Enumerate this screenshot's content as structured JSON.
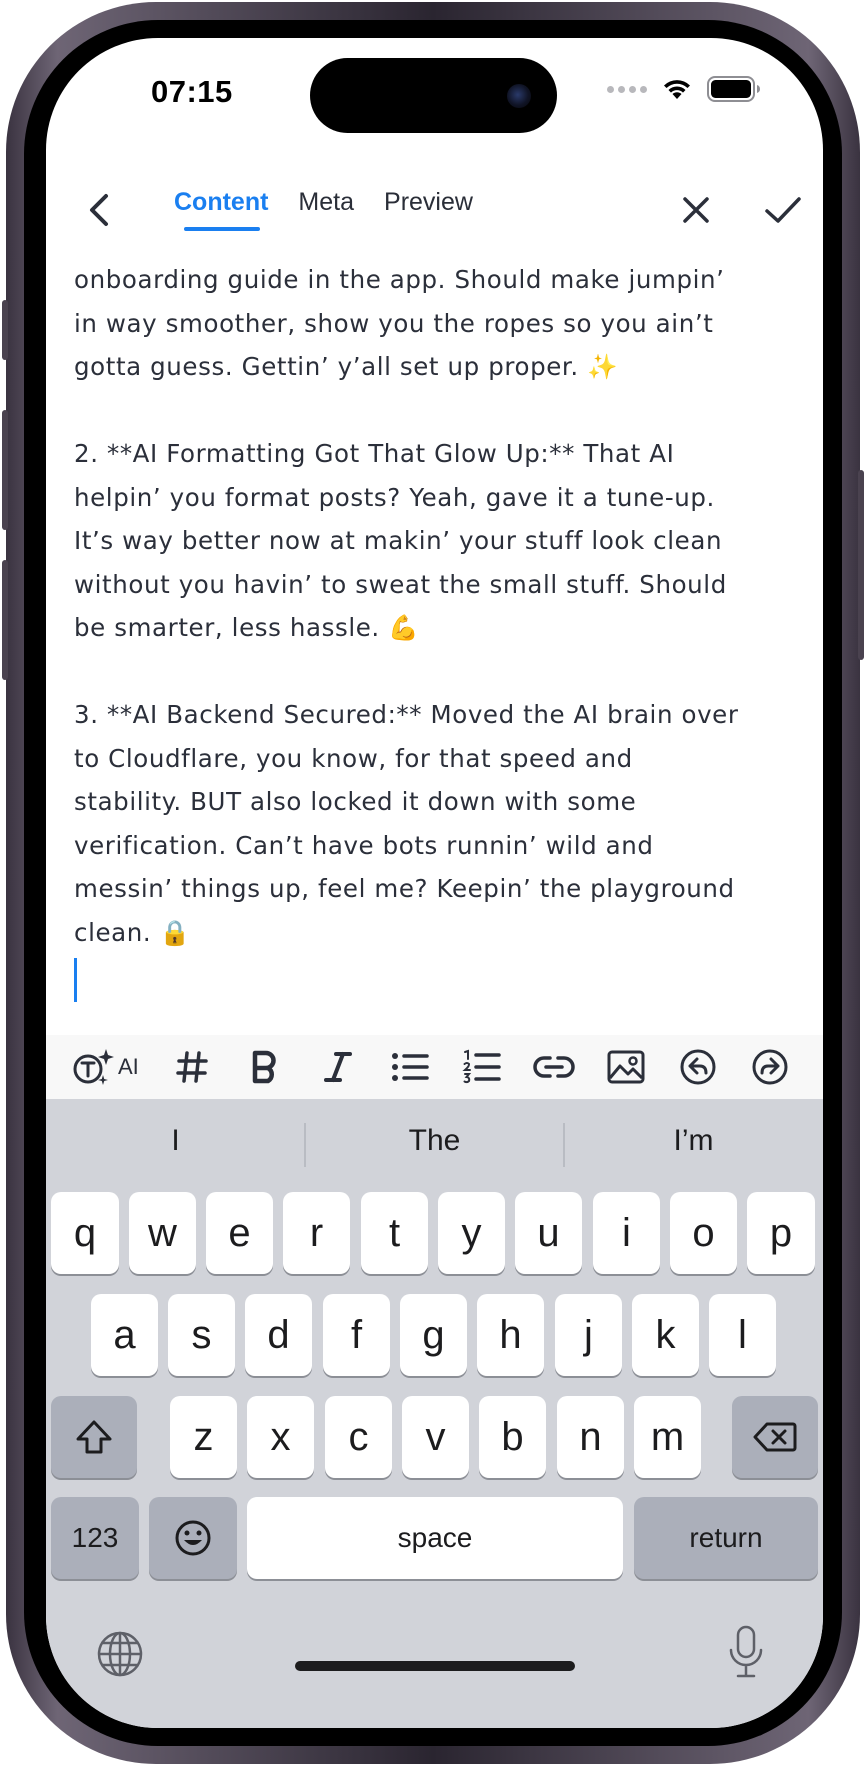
{
  "status_bar": {
    "time": "07:15"
  },
  "editor": {
    "tabs": [
      {
        "label": "Content",
        "active": true
      },
      {
        "label": "Meta",
        "active": false
      },
      {
        "label": "Preview",
        "active": false
      }
    ],
    "accent_color": "#1a7ff0"
  },
  "content": {
    "lines": [
      "onboarding guide in the app. Should make jumpin’",
      "in way smoother, show you the ropes so you ain’t",
      "gotta guess. Gettin’ y’all set up proper. ✨",
      "",
      "2.  **AI Formatting Got That Glow Up:** That AI",
      "helpin’ you format posts? Yeah, gave it a tune-up.",
      "It’s way better now at makin’ your stuff look clean",
      "without you havin’ to sweat the small stuff. Should",
      "be smarter, less hassle. 💪",
      "",
      "3.  **AI Backend Secured:** Moved the AI brain over",
      "to Cloudflare, you know, for that speed and",
      "stability. BUT also locked it down with some",
      "verification. Can’t have bots runnin’ wild and",
      "messin’ things up, feel me? Keepin’ the playground",
      "clean. 🔒"
    ]
  },
  "toolbar": {
    "ai_label": "AI",
    "tools": [
      "ai-icon",
      "hashtag-icon",
      "bold-icon",
      "italic-icon",
      "bullet-list-icon",
      "numbered-list-icon",
      "link-icon",
      "image-icon",
      "undo-icon",
      "redo-icon"
    ]
  },
  "keyboard": {
    "suggestions": [
      "I",
      "The",
      "I’m"
    ],
    "row1": [
      "q",
      "w",
      "e",
      "r",
      "t",
      "y",
      "u",
      "i",
      "o",
      "p"
    ],
    "row2": [
      "a",
      "s",
      "d",
      "f",
      "g",
      "h",
      "j",
      "k",
      "l"
    ],
    "row3": [
      "z",
      "x",
      "c",
      "v",
      "b",
      "n",
      "m"
    ],
    "numbers_label": "123",
    "space_label": "space",
    "return_label": "return"
  }
}
